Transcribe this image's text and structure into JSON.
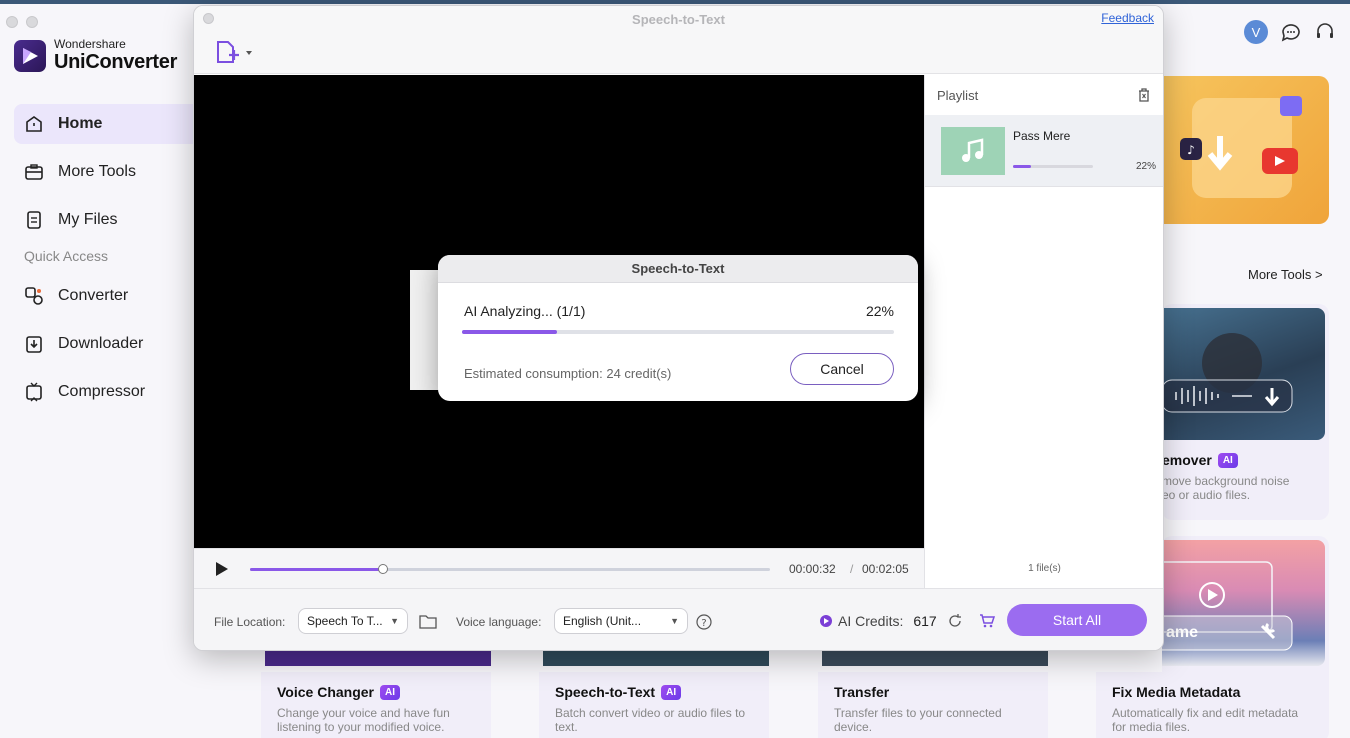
{
  "app": {
    "brand_small": "Wondershare",
    "brand_big": "UniConverter",
    "nav": [
      {
        "label": "Home",
        "icon": "home-icon",
        "active": true
      },
      {
        "label": "More Tools",
        "icon": "toolbox-icon"
      },
      {
        "label": "My Files",
        "icon": "files-icon"
      }
    ],
    "quick_access_label": "Quick Access",
    "quick_items": [
      {
        "label": "Converter",
        "icon": "converter-icon"
      },
      {
        "label": "Downloader",
        "icon": "downloader-icon"
      },
      {
        "label": "Compressor",
        "icon": "compressor-icon"
      }
    ],
    "avatar_letter": "V",
    "more_tools_link": "More Tools >",
    "cards": {
      "noise": {
        "title": "emover",
        "badge": "AI",
        "desc1": "move background noise",
        "desc2": "eo or audio files."
      },
      "rename": {
        "overlay_text": "ame"
      }
    },
    "bottom_cards": [
      {
        "title": "Voice Changer",
        "badge": "AI",
        "desc": "Change your voice and have fun listening to your modified voice."
      },
      {
        "title": "Speech-to-Text",
        "badge": "AI",
        "desc": "Batch convert video or audio files to text."
      },
      {
        "title": "Transfer",
        "badge": "",
        "desc": "Transfer files to your connected device."
      },
      {
        "title": "Fix Media Metadata",
        "badge": "",
        "desc": "Automatically fix and edit metadata for media files."
      }
    ]
  },
  "stt": {
    "title": "Speech-to-Text",
    "feedback": "Feedback",
    "playlist": {
      "header": "Playlist",
      "items": [
        {
          "name": "Pass Mere",
          "progress_pct": "22%",
          "progress": 0.22
        }
      ],
      "count": "1 file(s)"
    },
    "player": {
      "current_time": "00:00:32",
      "separator": "/",
      "total_time": "00:02:05",
      "progress": 0.256
    },
    "footer": {
      "file_location_label": "File Location:",
      "file_location_value": "Speech To T...",
      "voice_language_label": "Voice language:",
      "voice_language_value": "English (Unit...",
      "ai_credits_label": "AI Credits:",
      "ai_credits_value": "617",
      "start_all": "Start All"
    },
    "dialog": {
      "title": "Speech-to-Text",
      "status": "AI Analyzing... (1/1)",
      "percent": "22%",
      "progress": 0.22,
      "estimate": "Estimated consumption: 24 credit(s)",
      "cancel": "Cancel"
    }
  }
}
